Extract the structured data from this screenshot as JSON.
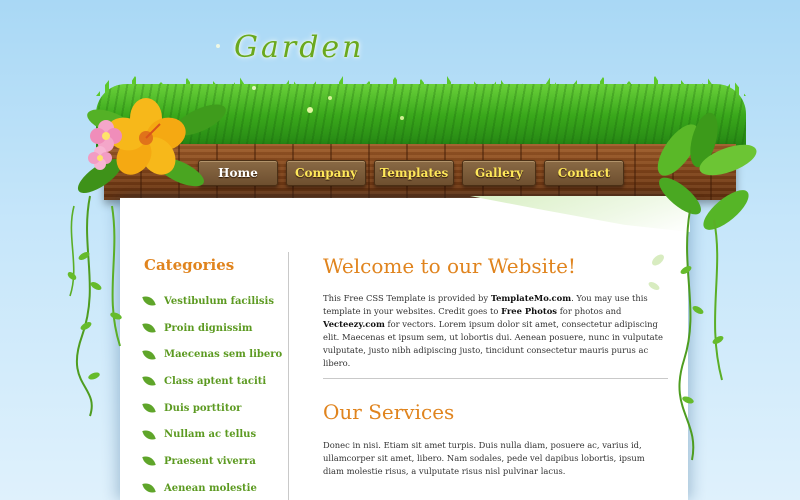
{
  "logo": {
    "text": "Garden"
  },
  "nav": [
    {
      "label": "Home",
      "active": true
    },
    {
      "label": "Company",
      "active": false
    },
    {
      "label": "Templates",
      "active": false
    },
    {
      "label": "Gallery",
      "active": false
    },
    {
      "label": "Contact",
      "active": false
    }
  ],
  "sidebar": {
    "title": "Categories",
    "items": [
      "Vestibulum facilisis",
      "Proin dignissim",
      "Maecenas sem libero",
      "Class aptent taciti",
      "Duis porttitor",
      "Nullam ac tellus",
      "Praesent viverra",
      "Aenean molestie"
    ]
  },
  "welcome": {
    "heading": "Welcome to our Website!",
    "intro_1": "This Free CSS Template is provided by ",
    "link_templatemo": "TemplateMo.com",
    "intro_2": ". You may use this template in your websites. Credit goes to ",
    "link_free_photos": "Free Photos",
    "intro_3": " for photos and ",
    "link_vecteezy": "Vecteezy.com",
    "intro_4": " for vectors. Lorem ipsum dolor sit amet, consectetur adipiscing elit. Maecenas et ipsum sem, ut lobortis dui. Aenean posuere, nunc in vulputate vulputate, justo nibh adipiscing justo, tincidunt consectetur mauris purus ac libero."
  },
  "services": {
    "heading": "Our Services",
    "text": "Donec in nisi. Etiam sit amet turpis. Duis nulla diam, posuere ac, varius id, ullamcorper sit amet, libero. Nam sodales, pede vel dapibus lobortis, ipsum diam molestie risus, a vulputate risus nisl pulvinar lacus."
  },
  "colors": {
    "heading_orange": "#e0841e",
    "category_green": "#5c9a21",
    "nav_text_yellow": "#ffe85a",
    "sky_blue": "#a9d8f5"
  },
  "icons": {
    "category_bullet": "leaf-icon",
    "header_flower": "hibiscus-flower-icon"
  }
}
